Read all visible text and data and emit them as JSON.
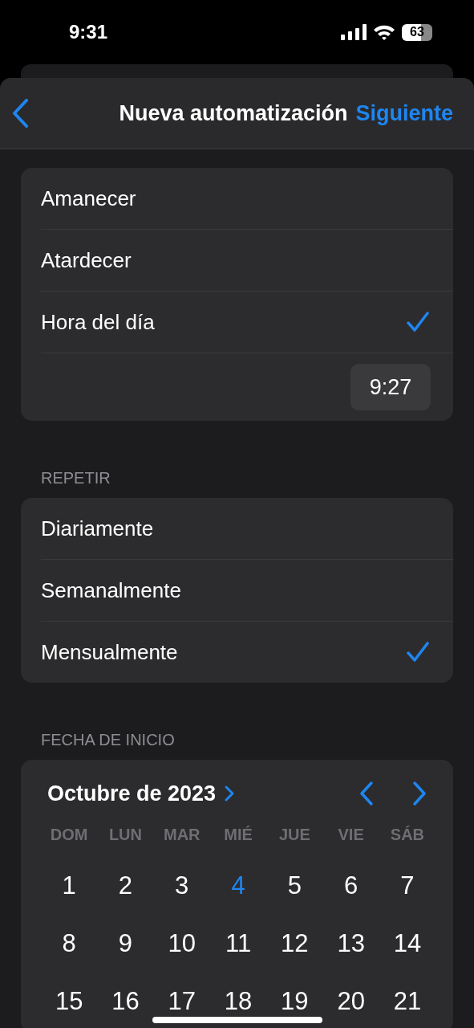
{
  "status_bar": {
    "time": "9:31",
    "battery": "63"
  },
  "nav": {
    "title": "Nueva automatización",
    "action": "Siguiente"
  },
  "trigger_options": [
    {
      "label": "Amanecer",
      "checked": false
    },
    {
      "label": "Atardecer",
      "checked": false
    },
    {
      "label": "Hora del día",
      "checked": true
    }
  ],
  "time_value": "9:27",
  "repeat": {
    "header": "REPETIR",
    "options": [
      {
        "label": "Diariamente",
        "checked": false
      },
      {
        "label": "Semanalmente",
        "checked": false
      },
      {
        "label": "Mensualmente",
        "checked": true
      }
    ]
  },
  "start_date": {
    "header": "FECHA DE INICIO",
    "month": "Octubre de 2023",
    "weekdays": [
      "DOM",
      "LUN",
      "MAR",
      "MIÉ",
      "JUE",
      "VIE",
      "SÁB"
    ],
    "weeks": [
      [
        {
          "day": "1",
          "today": false
        },
        {
          "day": "2",
          "today": false
        },
        {
          "day": "3",
          "today": false
        },
        {
          "day": "4",
          "today": true
        },
        {
          "day": "5",
          "today": false
        },
        {
          "day": "6",
          "today": false
        },
        {
          "day": "7",
          "today": false
        }
      ],
      [
        {
          "day": "8",
          "today": false
        },
        {
          "day": "9",
          "today": false
        },
        {
          "day": "10",
          "today": false
        },
        {
          "day": "11",
          "today": false
        },
        {
          "day": "12",
          "today": false
        },
        {
          "day": "13",
          "today": false
        },
        {
          "day": "14",
          "today": false
        }
      ],
      [
        {
          "day": "15",
          "today": false
        },
        {
          "day": "16",
          "today": false
        },
        {
          "day": "17",
          "today": false
        },
        {
          "day": "18",
          "today": false
        },
        {
          "day": "19",
          "today": false
        },
        {
          "day": "20",
          "today": false
        },
        {
          "day": "21",
          "today": false
        }
      ]
    ]
  }
}
